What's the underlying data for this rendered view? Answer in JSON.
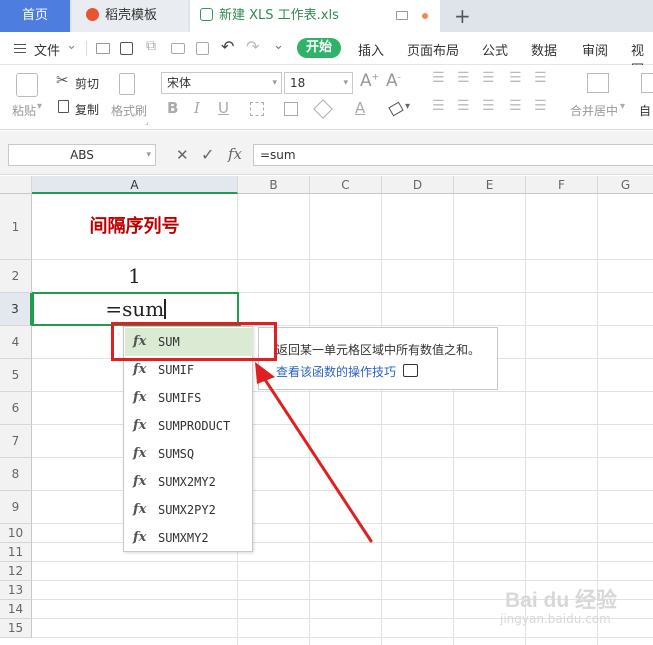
{
  "tabs": {
    "home": "首页",
    "docer": "稻壳模板",
    "file": "新建 XLS 工作表.xls",
    "add": "+"
  },
  "menu": {
    "file": "文件",
    "start": "开始",
    "insert": "插入",
    "layout": "页面布局",
    "formula": "公式",
    "data": "数据",
    "review": "审阅",
    "view": "视图"
  },
  "ribbon": {
    "paste": "粘贴",
    "cut": "剪切",
    "copy": "复制",
    "format_painter": "格式刷",
    "font": "宋体",
    "size": "18",
    "merge": "合并居中",
    "auto": "自"
  },
  "formula_bar": {
    "name_box": "ABS",
    "fx": "fx",
    "content": "=sum"
  },
  "columns": [
    "A",
    "B",
    "C",
    "D",
    "E",
    "F",
    "G"
  ],
  "rows": [
    "1",
    "2",
    "3",
    "4",
    "5",
    "6",
    "7",
    "8",
    "9",
    "10",
    "11",
    "12",
    "13",
    "14",
    "15"
  ],
  "cells": {
    "a1": "间隔序列号",
    "a2": "1",
    "a3": "=sum"
  },
  "autocomplete": {
    "fx": "fx",
    "items": [
      "SUM",
      "SUMIF",
      "SUMIFS",
      "SUMPRODUCT",
      "SUMSQ",
      "SUMX2MY2",
      "SUMX2PY2",
      "SUMXMY2"
    ]
  },
  "tooltip": {
    "desc": "返回某一单元格区域中所有数值之和。",
    "link": "查看该函数的操作技巧"
  },
  "watermark": {
    "text": "Bai du 经验",
    "sub": "jingyan.baidu.com"
  },
  "colors": {
    "accent": "#4e7de0",
    "start_tab": "#2fb26a",
    "title_red": "#c00000",
    "highlight": "#e02020"
  }
}
